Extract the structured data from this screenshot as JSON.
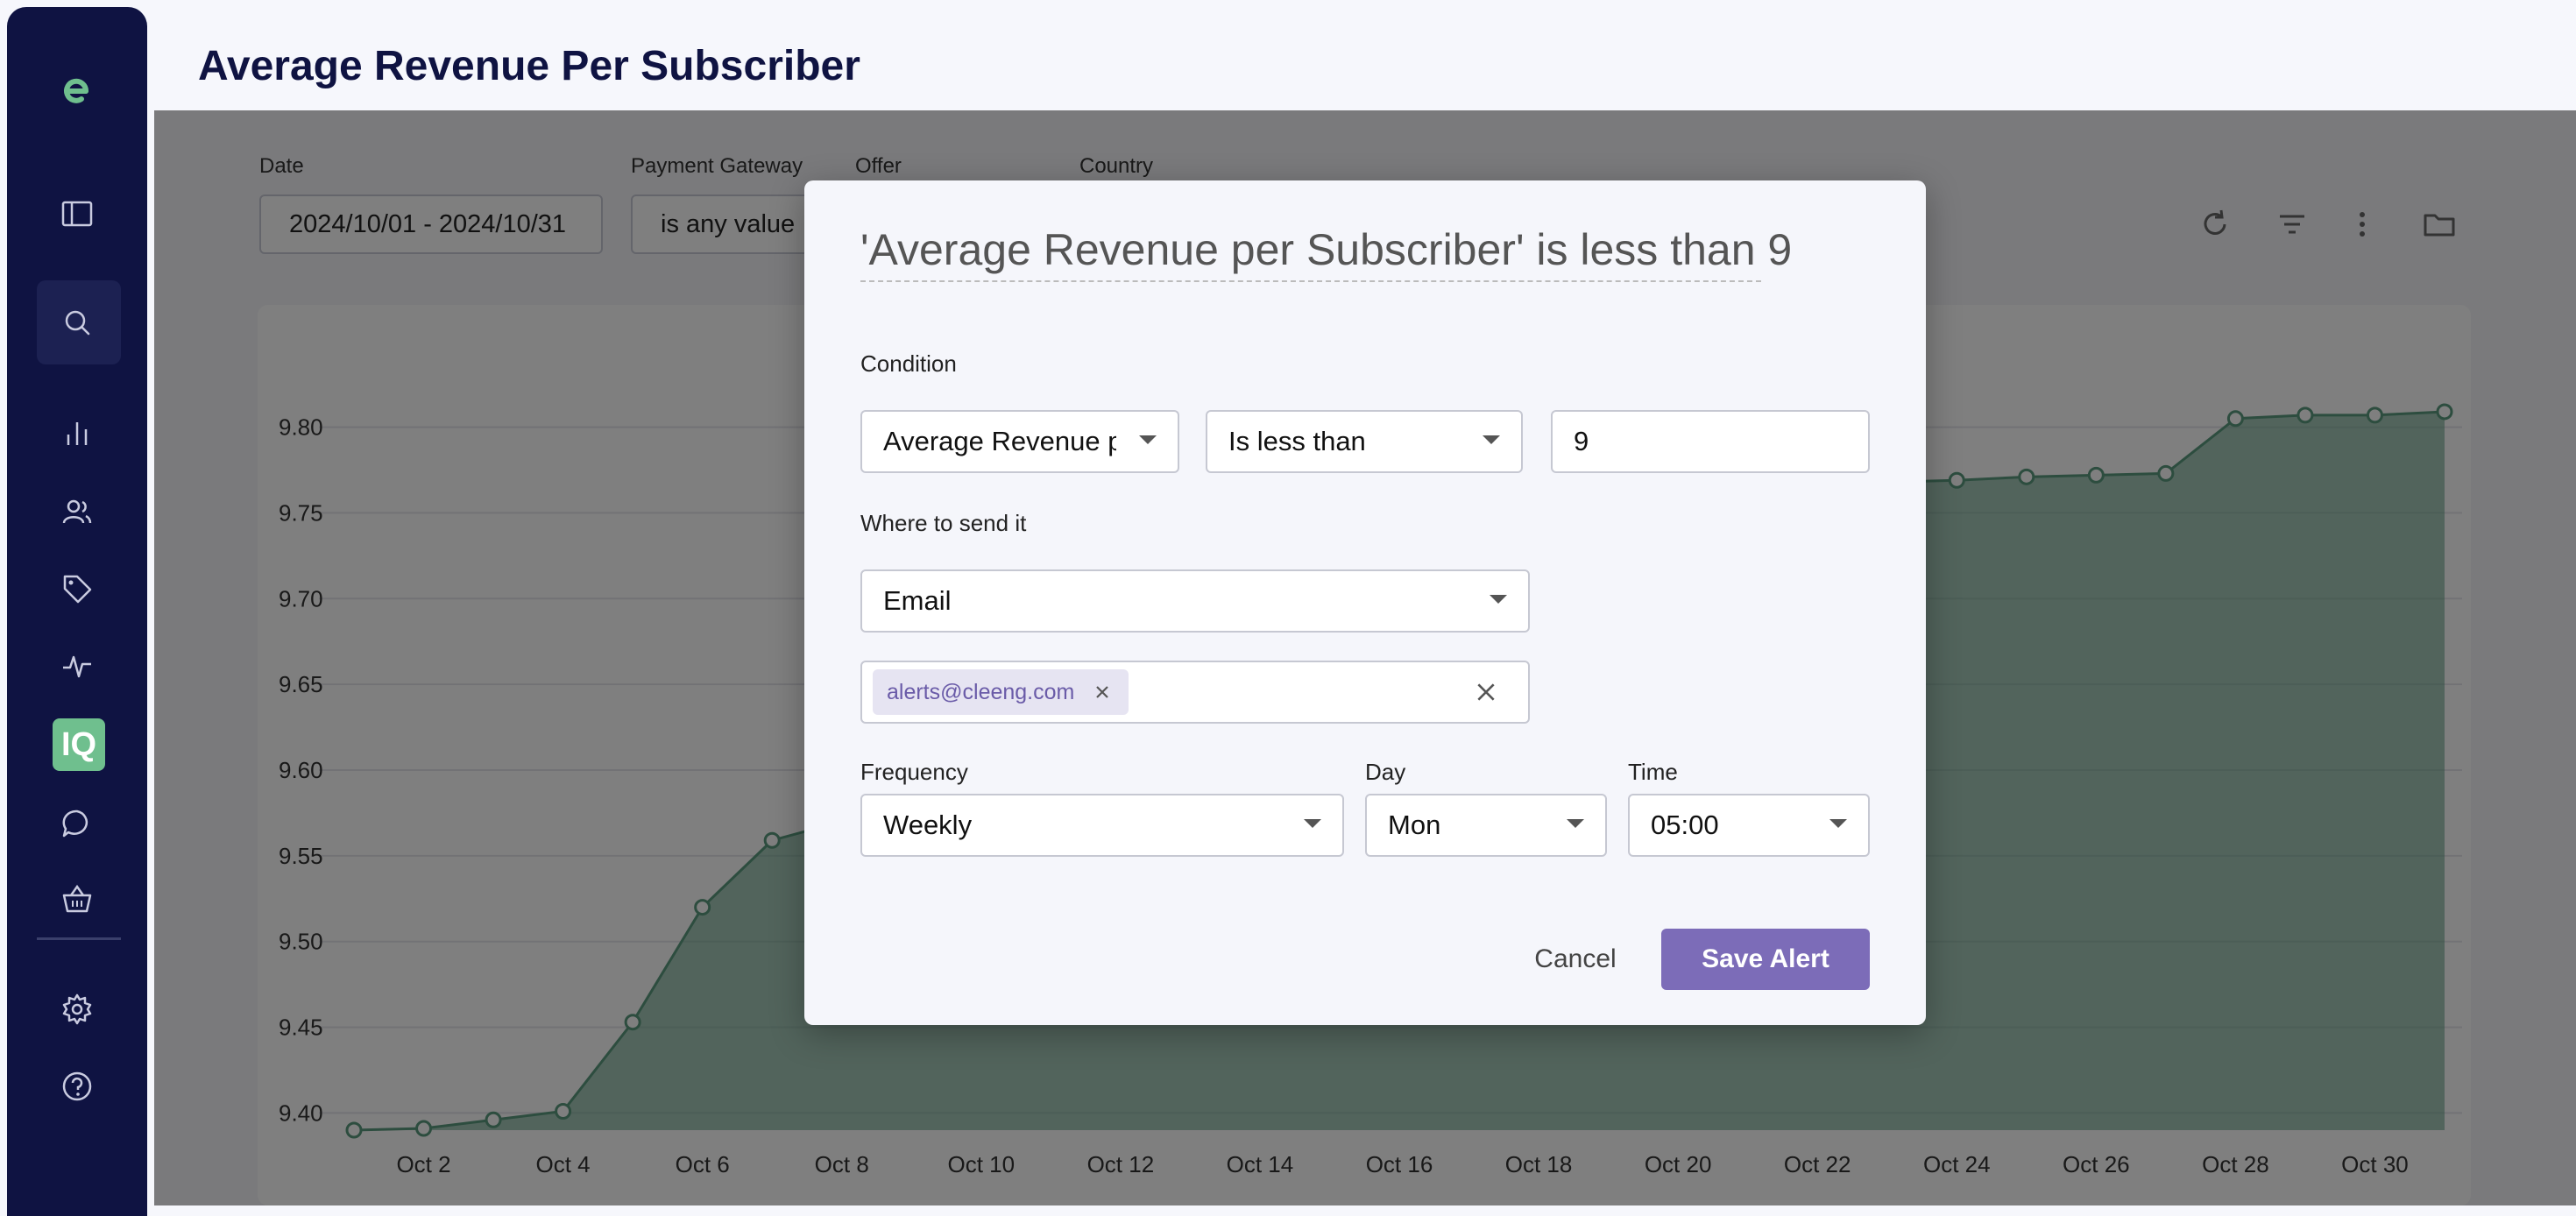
{
  "page": {
    "title": "Average Revenue Per Subscriber"
  },
  "sidebar": {
    "items": [
      {
        "icon": "logo-icon"
      },
      {
        "icon": "sidebar-toggle-icon"
      },
      {
        "icon": "search-icon"
      },
      {
        "icon": "bar-chart-icon"
      },
      {
        "icon": "users-icon"
      },
      {
        "icon": "tag-icon"
      },
      {
        "icon": "activity-icon"
      },
      {
        "icon": "iq-icon",
        "label": "IQ"
      },
      {
        "icon": "chat-icon"
      },
      {
        "icon": "basket-icon"
      },
      {
        "icon": "gear-icon"
      },
      {
        "icon": "help-icon"
      }
    ]
  },
  "filters": {
    "date": {
      "label": "Date",
      "value": "2024/10/01 - 2024/10/31"
    },
    "payment_gateway": {
      "label": "Payment Gateway",
      "value": "is any value"
    },
    "offer": {
      "label": "Offer"
    },
    "country": {
      "label": "Country"
    }
  },
  "toolbar": {
    "icons": [
      "refresh-icon",
      "filter-icon",
      "more-vert-icon",
      "folder-icon"
    ]
  },
  "chart_data": {
    "type": "area",
    "x": [
      "Oct 1",
      "Oct 2",
      "Oct 3",
      "Oct 4",
      "Oct 5",
      "Oct 6",
      "Oct 7",
      "Oct 8",
      "Oct 9",
      "Oct 10",
      "Oct 11",
      "Oct 12",
      "Oct 13",
      "Oct 14",
      "Oct 15",
      "Oct 16",
      "Oct 17",
      "Oct 18",
      "Oct 19",
      "Oct 20",
      "Oct 21",
      "Oct 22",
      "Oct 23",
      "Oct 24",
      "Oct 25",
      "Oct 26",
      "Oct 27",
      "Oct 28",
      "Oct 29",
      "Oct 30",
      "Oct 31"
    ],
    "tick_labels": [
      "Oct 2",
      "Oct 4",
      "Oct 6",
      "Oct 8",
      "Oct 10",
      "Oct 12",
      "Oct 14",
      "Oct 16",
      "Oct 18",
      "Oct 20",
      "Oct 22",
      "Oct 24",
      "Oct 26",
      "Oct 28",
      "Oct 30"
    ],
    "y_ticks": [
      "9.80",
      "9.75",
      "9.70",
      "9.65",
      "9.60",
      "9.55",
      "9.50",
      "9.45",
      "9.40"
    ],
    "ylim": [
      9.39,
      9.81
    ],
    "values": [
      9.39,
      9.391,
      9.396,
      9.401,
      9.453,
      9.52,
      9.559,
      9.57,
      9.6,
      9.62,
      9.64,
      9.66,
      9.68,
      9.7,
      9.71,
      9.72,
      9.73,
      9.74,
      9.75,
      9.755,
      9.76,
      9.765,
      9.768,
      9.769,
      9.771,
      9.772,
      9.773,
      9.805,
      9.807,
      9.807,
      9.809
    ],
    "color": "#5a9a7e",
    "grid": true
  },
  "dialog": {
    "title": "'Average Revenue per Subscriber' is less than 9",
    "condition_label": "Condition",
    "metric_value": "Average Revenue per Subscriber",
    "operator_value": "Is less than",
    "threshold_value": "9",
    "destination_label": "Where to send it",
    "destination_value": "Email",
    "email_chip": "alerts@cleeng.com",
    "frequency_label": "Frequency",
    "frequency_value": "Weekly",
    "day_label": "Day",
    "day_value": "Mon",
    "time_label": "Time",
    "time_value": "05:00",
    "cancel_label": "Cancel",
    "save_label": "Save Alert"
  },
  "colors": {
    "sidebar": "#0f1342",
    "accent": "#7c6cb8",
    "iq": "#6fbf8e"
  }
}
